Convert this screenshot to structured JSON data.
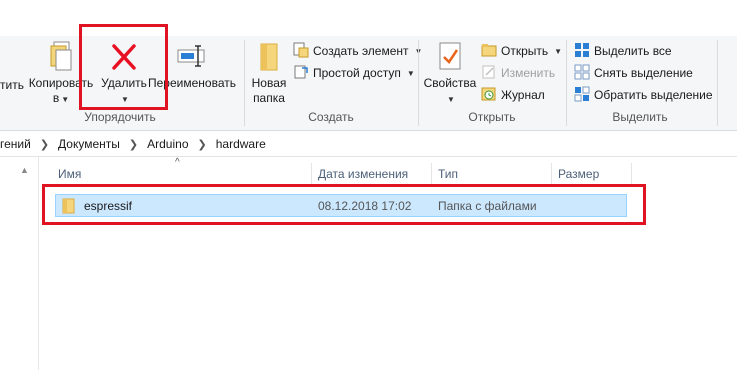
{
  "ribbon": {
    "organize": {
      "move_label": "тить",
      "copy_label_line1": "Копировать",
      "copy_label_line2": "в",
      "delete_label": "Удалить",
      "rename_label": "Переименовать",
      "group_label": "Упорядочить"
    },
    "create": {
      "new_folder_line1": "Новая",
      "new_folder_line2": "папка",
      "new_item": "Создать элемент",
      "easy_access": "Простой доступ",
      "group_label": "Создать"
    },
    "open": {
      "properties": "Свойства",
      "open": "Открыть",
      "edit": "Изменить",
      "history": "Журнал",
      "group_label": "Открыть"
    },
    "select": {
      "select_all": "Выделить все",
      "select_none": "Снять выделение",
      "invert": "Обратить выделение",
      "group_label": "Выделить"
    }
  },
  "breadcrumb": [
    "гений",
    "Документы",
    "Arduino",
    "hardware"
  ],
  "columns": {
    "name": "Имя",
    "modified": "Дата изменения",
    "type": "Тип",
    "size": "Размер"
  },
  "files": [
    {
      "name": "espressif",
      "modified": "08.12.2018 17:02",
      "type": "Папка с файлами",
      "size": ""
    }
  ],
  "colors": {
    "highlight": "#e01322",
    "selection": "#cce8ff",
    "delete_x": "#e81123"
  }
}
